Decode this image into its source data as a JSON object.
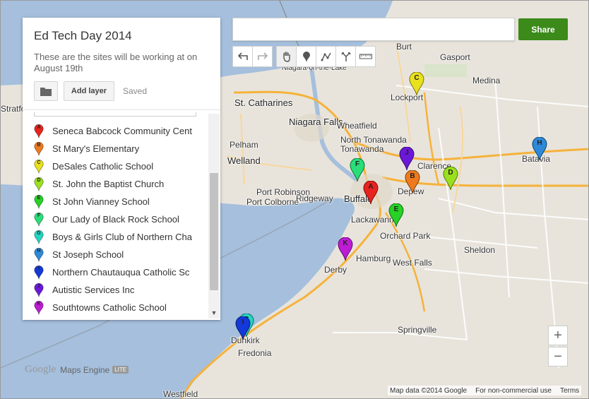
{
  "map": {
    "title": "Ed Tech Day 2014",
    "description": "These are the sites will be working at on August 19th",
    "add_layer_label": "Add layer",
    "saved_label": "Saved",
    "locations": [
      {
        "letter": "A",
        "name": "Seneca Babcock Community Cent",
        "color": "#e8231e"
      },
      {
        "letter": "B",
        "name": "St Mary's Elementary",
        "color": "#ee7a1d"
      },
      {
        "letter": "C",
        "name": "DeSales Catholic School",
        "color": "#e9e11e"
      },
      {
        "letter": "D",
        "name": "St. John the Baptist Church",
        "color": "#9be01e"
      },
      {
        "letter": "E",
        "name": "St John Vianney School",
        "color": "#27d126"
      },
      {
        "letter": "F",
        "name": "Our Lady of Black Rock School",
        "color": "#28de78"
      },
      {
        "letter": "G",
        "name": "Boys & Girls Club of Northern Cha",
        "color": "#22d6c2"
      },
      {
        "letter": "H",
        "name": "St Joseph School",
        "color": "#2e8ad8"
      },
      {
        "letter": "I",
        "name": "Northern Chautauqua Catholic Sc",
        "color": "#1438d9"
      },
      {
        "letter": "J",
        "name": "Autistic Services Inc",
        "color": "#6b18d8"
      },
      {
        "letter": "K",
        "name": "Southtowns Catholic School",
        "color": "#bd1cd4"
      }
    ]
  },
  "search": {
    "placeholder": ""
  },
  "share_label": "Share",
  "toolbar": {
    "icons": [
      "undo-icon",
      "redo-icon",
      "hand-pan-icon",
      "add-marker-icon",
      "draw-line-icon",
      "route-directions-icon",
      "measure-ruler-icon"
    ]
  },
  "zoom": {
    "in_label": "+",
    "out_label": "−"
  },
  "logo": {
    "google": "Google",
    "product": "Maps Engine",
    "badge": "LITE"
  },
  "attribution": {
    "data": "Map data ©2014 Google",
    "usage": "For non-commercial use",
    "terms": "Terms"
  },
  "place_labels": [
    "St. Catharines",
    "Niagara Falls",
    "Niagara-on-the-Lake",
    "Lockport",
    "Gasport",
    "Medina",
    "Wheatfield",
    "North Tonawanda",
    "Tonawanda",
    "Clarence",
    "Batavia",
    "Depew",
    "Buffalo",
    "Lackawanna",
    "Orchard Park",
    "Hamburg",
    "West Falls",
    "Derby",
    "Sheldon",
    "Springville",
    "Dunkirk",
    "Fredonia",
    "Welland",
    "Port Colborne",
    "Ridgeway",
    "Port Robinson",
    "Pelham",
    "Burt",
    "Westfield",
    "Stratford"
  ]
}
